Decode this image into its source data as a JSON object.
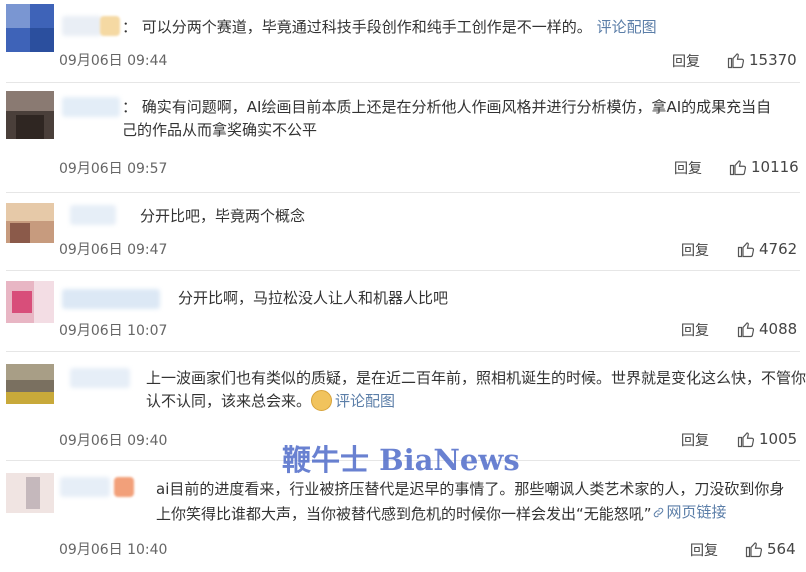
{
  "comments": [
    {
      "text": "： 可以分两个赛道，毕竟通过科技手段创作和纯手工创作是不一样的。",
      "link": "评论配图",
      "date": "09月06日 09:44",
      "reply": "回复",
      "likes": "15370"
    },
    {
      "text": "： 确实有问题啊，AI绘画目前本质上还是在分析他人作画风格并进行分析模仿，拿AI的成果充当自己的作品从而拿奖确实不公平",
      "date": "09月06日 09:57",
      "reply": "回复",
      "likes": "10116"
    },
    {
      "text": "分开比吧，毕竟两个概念",
      "date": "09月06日 09:47",
      "reply": "回复",
      "likes": "4762"
    },
    {
      "text": "分开比啊，马拉松没人让人和机器人比吧",
      "date": "09月06日 10:07",
      "reply": "回复",
      "likes": "4088"
    },
    {
      "text": "上一波画家们也有类似的质疑，是在近二百年前，照相机诞生的时候。世界就是变化这么快，不管你认不认同，该来总会来。",
      "link": "评论配图",
      "date": "09月06日 09:40",
      "reply": "回复",
      "likes": "1005"
    },
    {
      "text": "ai目前的进度看来，行业被挤压替代是迟早的事情了。那些嘲讽人类艺术家的人，刀没砍到你身上你笑得比谁都大声，当你被替代感到危机的时候你一样会发出“无能怒吼”",
      "link": "网页链接",
      "date": "09月06日 10:40",
      "reply": "回复",
      "likes": "564"
    }
  ],
  "watermark": "鞭牛士 BiaNews",
  "colors": {
    "link": "#5b7ea8",
    "divider": "#e6e6e6",
    "watermark": "#4f6cc9"
  },
  "icons": {
    "like": "thumbs-up-icon",
    "emoji": "doge-emoji-icon",
    "link": "link-icon"
  }
}
